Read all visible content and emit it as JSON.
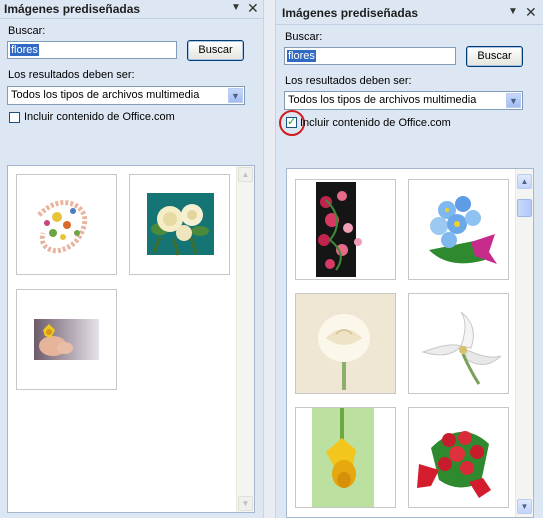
{
  "left_pane": {
    "title": "Imágenes prediseñadas",
    "search_label": "Buscar:",
    "search_value": "flores",
    "search_button": "Buscar",
    "results_label": "Los resultados deben ser:",
    "media_type": "Todos los tipos de archivos multimedia",
    "include_office_label": "Incluir contenido de Office.com",
    "include_office_checked": false,
    "thumbnails": [
      "floral-border-clipart",
      "white-roses-teal",
      "child-hands-flower-photo"
    ]
  },
  "right_pane": {
    "title": "Imágenes prediseñadas",
    "search_label": "Buscar:",
    "search_value": "flores",
    "search_button": "Buscar",
    "results_label": "Los resultados deben ser:",
    "media_type": "Todos los tipos de archivos multimedia",
    "include_office_label": "Incluir contenido de Office.com",
    "include_office_checked": true,
    "thumbnails": [
      "floral-vine-black",
      "blue-flower-bouquet",
      "white-rose-photo",
      "white-lily-photo",
      "yellow-daffodil-photo",
      "red-rose-bouquet"
    ]
  },
  "icons": {
    "dropdown": "▼",
    "close": "✕",
    "scroll_up": "▲",
    "scroll_down": "▼",
    "check": "✓"
  },
  "colors": {
    "pane_bg": "#dde7f3",
    "highlight_ring": "#d01c1c",
    "selection": "#316ac5"
  }
}
